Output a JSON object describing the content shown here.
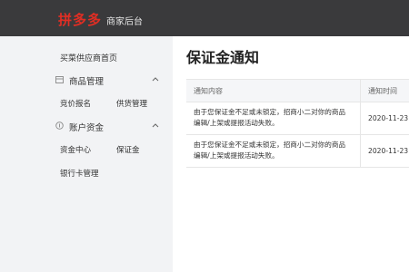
{
  "header": {
    "logo": "拼多多",
    "subtitle": "商家后台"
  },
  "sidebar": {
    "home": "买菜供应商首页",
    "sections": [
      {
        "title": "商品管理",
        "icon": "box-icon",
        "items": [
          "竞价报名",
          "供货管理"
        ]
      },
      {
        "title": "账户资金",
        "icon": "coin-icon",
        "items": [
          "资金中心",
          "保证金",
          "银行卡管理"
        ]
      }
    ]
  },
  "main": {
    "title": "保证金通知",
    "table": {
      "columns": [
        "通知内容",
        "通知时间"
      ],
      "rows": [
        {
          "content_line1": "由于您保证金不足或未锁定，招商小二对你的商品",
          "content_line2": "编辑/上架或提报活动失败。",
          "time": "2020-11-23"
        },
        {
          "content_line1": "由于您保证金不足或未锁定，招商小二对你的商品",
          "content_line2": "编辑/上架或提报活动失败。",
          "time": "2020-11-23"
        }
      ]
    }
  },
  "colors": {
    "topbar": "#3a3a3c",
    "brand": "#e02e24",
    "sidebar": "#f2f3f5"
  }
}
